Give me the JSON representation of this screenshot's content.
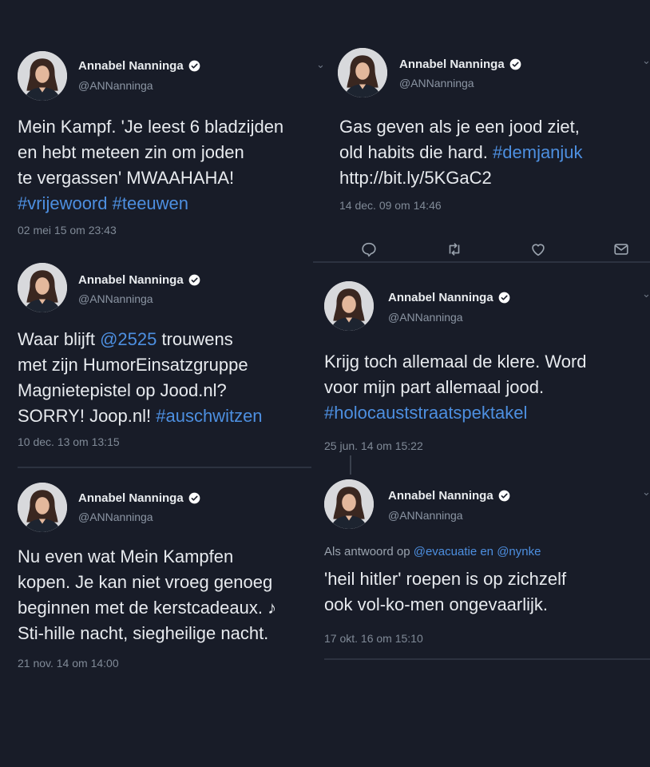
{
  "colors": {
    "background": "#181c28",
    "text": "#e7eaee",
    "link": "#4d8fe0",
    "muted": "#8b95a3",
    "verified": "#ffffff"
  },
  "tweets": [
    {
      "name": "Annabel Nanninga",
      "handle": "@ANNanninga",
      "lines": [
        [
          {
            "t": "Mein Kampf. 'Je leest 6 bladzijden"
          }
        ],
        [
          {
            "t": "en hebt meteen zin om joden"
          }
        ],
        [
          {
            "t": "te vergassen' MWAAHAHA!"
          }
        ],
        [
          {
            "t": "#vrijewoord #teeuwen",
            "link": true
          }
        ]
      ],
      "time": "02 mei 15 om 23:43"
    },
    {
      "name": "Annabel Nanninga",
      "handle": "@ANNanninga",
      "lines": [
        [
          {
            "t": "Gas geven als je een jood ziet,"
          }
        ],
        [
          {
            "t": "old habits die hard. "
          },
          {
            "t": "#demjanjuk",
            "link": true
          }
        ],
        [
          {
            "t": "http://bit.ly/5KGaC2"
          }
        ]
      ],
      "time": "14 dec. 09 om 14:46",
      "actions": [
        "reply-icon",
        "retweet-icon",
        "like-icon",
        "message-icon"
      ]
    },
    {
      "name": "Annabel Nanninga",
      "handle": "@ANNanninga",
      "lines": [
        [
          {
            "t": "Waar blijft "
          },
          {
            "t": "@2525",
            "link": true
          },
          {
            "t": " trouwens"
          }
        ],
        [
          {
            "t": "met zijn HumorEinsatzgruppe"
          }
        ],
        [
          {
            "t": "Magnietepistel op Jood.nl?"
          }
        ],
        [
          {
            "t": "SORRY! Joop.nl! "
          },
          {
            "t": "#auschwitzen",
            "link": true
          }
        ]
      ],
      "time": "10 dec. 13 om 13:15"
    },
    {
      "name": "Annabel Nanninga",
      "handle": "@ANNanninga",
      "lines": [
        [
          {
            "t": "Krijg toch allemaal de klere. Word"
          }
        ],
        [
          {
            "t": "voor mijn part allemaal jood."
          }
        ],
        [
          {
            "t": "#holocauststraatspektakel",
            "link": true
          }
        ]
      ],
      "time": "25 jun. 14 om 15:22"
    },
    {
      "name": "Annabel Nanninga",
      "handle": "@ANNanninga",
      "lines": [
        [
          {
            "t": "Nu even wat Mein Kampfen"
          }
        ],
        [
          {
            "t": "kopen. Je kan niet vroeg genoeg"
          }
        ],
        [
          {
            "t": "beginnen met de kerstcadeaux. ♪"
          }
        ],
        [
          {
            "t": "Sti-hille nacht, siegheilige nacht."
          }
        ]
      ],
      "time": "21 nov. 14 om 14:00"
    },
    {
      "name": "Annabel Nanninga",
      "handle": "@ANNanninga",
      "reply": [
        {
          "t": "Als antwoord op "
        },
        {
          "t": "@evacuatie en @nynke",
          "link": true
        }
      ],
      "lines": [
        [
          {
            "t": "'heil hitler' roepen is op zichzelf"
          }
        ],
        [
          {
            "t": "ook vol-ko-men ongevaarlijk."
          }
        ]
      ],
      "time": "17 okt. 16 om 15:10"
    }
  ]
}
